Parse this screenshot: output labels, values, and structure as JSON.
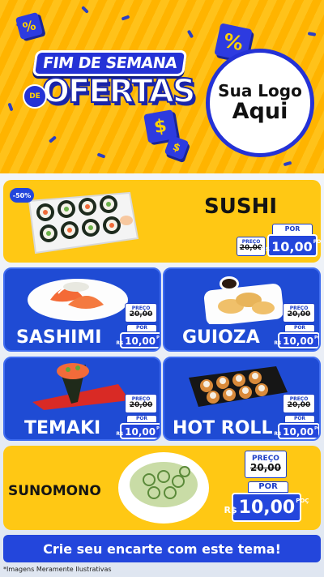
{
  "header": {
    "title_top": "FIM DE SEMANA",
    "title_de": "DE",
    "title_main": "OFERTAS",
    "logo_line1": "Sua Logo",
    "logo_line2": "Aqui",
    "cube_symbols": [
      "%",
      "$",
      "%",
      "$"
    ]
  },
  "badge": "-50%",
  "labels": {
    "preco": "PREÇO",
    "por": "POR",
    "currency": "R$",
    "cents_suffix": "POÇ"
  },
  "products": [
    {
      "name": "SUSHI",
      "old_price": "20,00",
      "price": "10,00",
      "image": "sushi-tray-image"
    },
    {
      "name": "SASHIMI",
      "old_price": "20,00",
      "price": "10,00",
      "image": "sashimi-plate-image"
    },
    {
      "name": "GUIOZA",
      "old_price": "20,00",
      "price": "10,00",
      "image": "guioza-plate-image"
    },
    {
      "name": "TEMAKI",
      "old_price": "20,00",
      "price": "10,00",
      "image": "temaki-plate-image"
    },
    {
      "name": "HOT ROLL",
      "old_price": "20,00",
      "price": "10,00",
      "image": "hot-roll-plate-image"
    },
    {
      "name": "SUNOMONO",
      "old_price": "20,00",
      "price": "10,00",
      "image": "sunomono-bowl-image"
    }
  ],
  "cta": "Crie seu encarte com este tema!",
  "footnote": "*Imagens Meramente Ilustrativas",
  "colors": {
    "yellow": "#ffc814",
    "blue": "#1f4bd4",
    "dark_blue": "#2432d6"
  }
}
